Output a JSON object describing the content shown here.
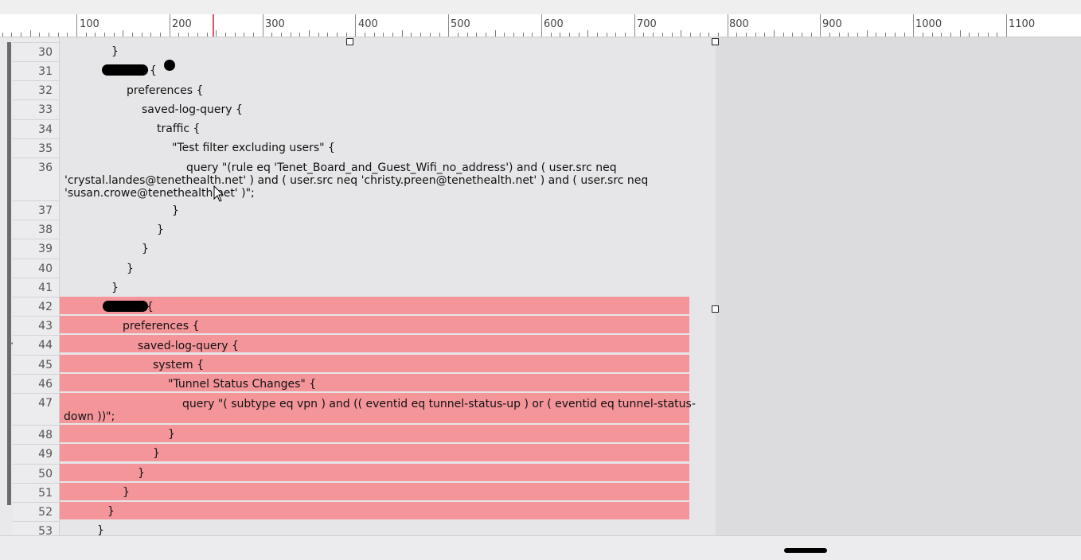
{
  "ruler": {
    "labels": [
      "100",
      "200",
      "300",
      "400",
      "500",
      "600",
      "700",
      "800",
      "900",
      "1000",
      "1100"
    ]
  },
  "lines": [
    {
      "num": "30",
      "text": "}"
    },
    {
      "num": "31",
      "text": "{"
    },
    {
      "num": "32",
      "text": "preferences {"
    },
    {
      "num": "33",
      "text": "saved-log-query {"
    },
    {
      "num": "34",
      "text": "traffic {"
    },
    {
      "num": "35",
      "text": "\"Test filter excluding users\" {"
    },
    {
      "num": "36",
      "text_1": "query \"(rule eq 'Tenet_Board_and_Guest_Wifi_no_address') and ( user.src neq",
      "text_2": "'crystal.landes@tenethealth.net' ) and ( user.src neq 'christy.preen@tenethealth.net' ) and ( user.src neq",
      "text_3": "'susan.crowe@tenethealth.net' )\";"
    },
    {
      "num": "37",
      "text": "}"
    },
    {
      "num": "38",
      "text": "}"
    },
    {
      "num": "39",
      "text": "}"
    },
    {
      "num": "40",
      "text": "}"
    },
    {
      "num": "41",
      "text": "}"
    },
    {
      "num": "42",
      "text": "{"
    },
    {
      "num": "43",
      "text": "preferences {"
    },
    {
      "num": "44",
      "text": "saved-log-query {"
    },
    {
      "num": "45",
      "text": "system {"
    },
    {
      "num": "46",
      "text": "\"Tunnel Status Changes\" {"
    },
    {
      "num": "47",
      "text_1": "query \"( subtype eq vpn ) and (( eventid eq tunnel-status-up ) or ( eventid eq tunnel-status-",
      "text_2": "down ))\";"
    },
    {
      "num": "48",
      "text": "}"
    },
    {
      "num": "49",
      "text": "}"
    },
    {
      "num": "50",
      "text": "}"
    },
    {
      "num": "51",
      "text": "}"
    },
    {
      "num": "52",
      "text": "}"
    },
    {
      "num": "53",
      "text": "}"
    }
  ],
  "colors": {
    "highlight": "#f4959a",
    "editor_bg": "#e6e6e8",
    "gutter_bg": "#ececef",
    "ruler_marker": "#e0506a"
  },
  "icons": [
    "mouse-pointer-icon",
    "selection-handle-icon",
    "redaction-mark"
  ]
}
